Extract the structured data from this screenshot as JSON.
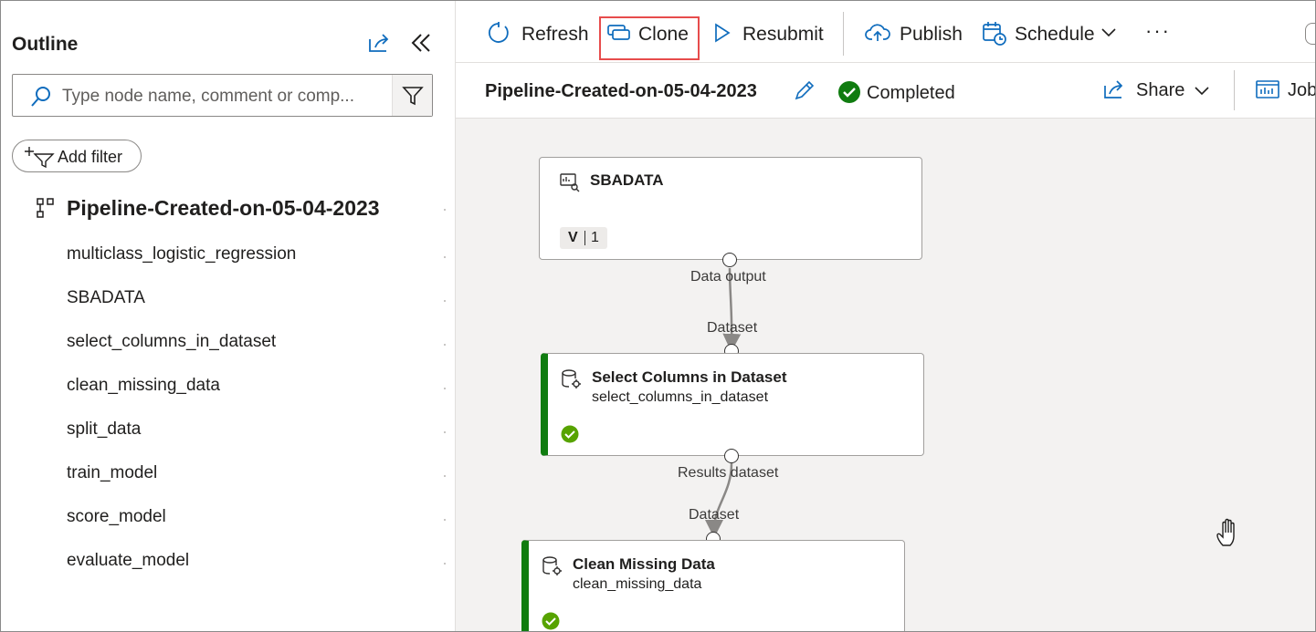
{
  "sidebar": {
    "title": "Outline",
    "search_placeholder": "Type node name, comment or comp...",
    "add_filter": "Add filter",
    "root": "Pipeline-Created-on-05-04-2023",
    "items": [
      "multiclass_logistic_regression",
      "SBADATA",
      "select_columns_in_dataset",
      "clean_missing_data",
      "split_data",
      "train_model",
      "score_model",
      "evaluate_model"
    ]
  },
  "toolbar": {
    "refresh": "Refresh",
    "clone": "Clone",
    "resubmit": "Resubmit",
    "publish": "Publish",
    "schedule": "Schedule",
    "more": "···"
  },
  "header": {
    "pipeline_name": "Pipeline-Created-on-05-04-2023",
    "status": "Completed",
    "share": "Share",
    "jobs": "Job"
  },
  "graph": {
    "nodes": [
      {
        "title": "SBADATA",
        "version_label": "V",
        "version": "1",
        "output_port": "Data output"
      },
      {
        "title": "Select Columns in Dataset",
        "subtitle": "select_columns_in_dataset",
        "input_port": "Dataset",
        "output_port": "Results dataset"
      },
      {
        "title": "Clean Missing Data",
        "subtitle": "clean_missing_data",
        "input_port": "Dataset"
      }
    ]
  },
  "colors": {
    "accent": "#0f6cbd",
    "success": "#107c10",
    "highlight_box": "#e74c4c",
    "canvas_bg": "#f3f2f1"
  }
}
